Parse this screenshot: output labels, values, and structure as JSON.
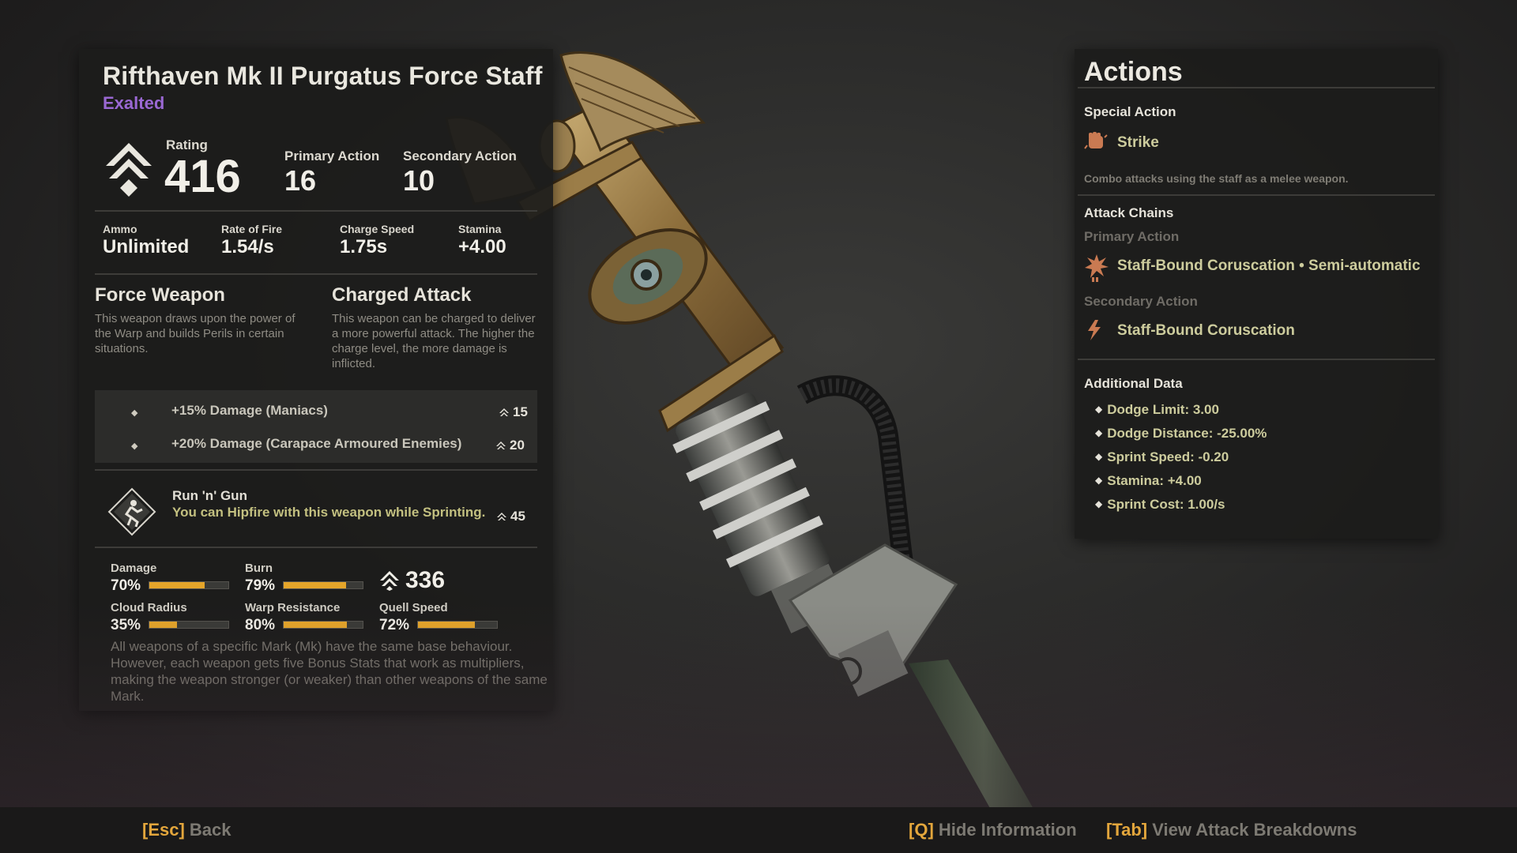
{
  "weapon": {
    "name": "Rifthaven Mk II Purgatus Force Staff",
    "rarity": "Exalted",
    "rating_label": "Rating",
    "rating": "416",
    "primary_label": "Primary Action",
    "primary_value": "16",
    "secondary_label": "Secondary Action",
    "secondary_value": "10"
  },
  "stats": [
    {
      "label": "Ammo",
      "value": "Unlimited"
    },
    {
      "label": "Rate of Fire",
      "value": "1.54/s"
    },
    {
      "label": "Charge Speed",
      "value": "1.75s"
    },
    {
      "label": "Stamina",
      "value": "+4.00"
    }
  ],
  "traits": [
    {
      "title": "Force Weapon",
      "desc": "This weapon draws upon the power of the Warp and builds Perils in certain situations."
    },
    {
      "title": "Charged Attack",
      "desc": "This weapon can be charged to deliver a more powerful attack. The higher the charge level, the more damage is inflicted."
    }
  ],
  "blessings": [
    {
      "text": "+15%  Damage (Maniacs)",
      "value": "15"
    },
    {
      "text": "+20% Damage (Carapace Armoured Enemies)",
      "value": "20"
    }
  ],
  "perk": {
    "name": "Run 'n' Gun",
    "desc": "You can Hipfire with this weapon while Sprinting.",
    "value": "45"
  },
  "modifiers": [
    {
      "label": "Damage",
      "value": "70%",
      "fraction": 0.7
    },
    {
      "label": "Burn",
      "value": "79%",
      "fraction": 0.79
    },
    {
      "label": "Cloud Radius",
      "value": "35%",
      "fraction": 0.35
    },
    {
      "label": "Warp Resistance",
      "value": "80%",
      "fraction": 0.8
    },
    {
      "label": "Quell Speed",
      "value": "72%",
      "fraction": 0.72
    }
  ],
  "base_rating": "336",
  "note": "All weapons of a specific Mark (Mk) have the same base behaviour. However, each weapon gets five Bonus Stats that work as multipliers, making the weapon stronger (or weaker) than other weapons of the same Mark.",
  "actions": {
    "title": "Actions",
    "special_label": "Special Action",
    "special_name": "Strike",
    "special_desc": "Combo attacks using the staff as a melee weapon.",
    "chains_label": "Attack Chains",
    "primary_label": "Primary Action",
    "primary_name": "Staff-Bound Coruscation • Semi-automatic",
    "secondary_label": "Secondary Action",
    "secondary_name": "Staff-Bound Coruscation",
    "additional_label": "Additional Data",
    "additional": [
      "Dodge Limit: 3.00",
      "Dodge Distance: -25.00%",
      "Sprint Speed: -0.20",
      "Stamina: +4.00",
      "Sprint Cost: 1.00/s"
    ]
  },
  "hints": [
    {
      "key": "[Esc]",
      "label": "Back"
    },
    {
      "key": "[Q]",
      "label": "Hide Information"
    },
    {
      "key": "[Tab]",
      "label": "View Attack Breakdowns"
    }
  ],
  "colors": {
    "rarity": "#9a68d3",
    "accent": "#e5a52a",
    "key_hint": "#e3a63c",
    "action_text": "#cdcc9d"
  }
}
